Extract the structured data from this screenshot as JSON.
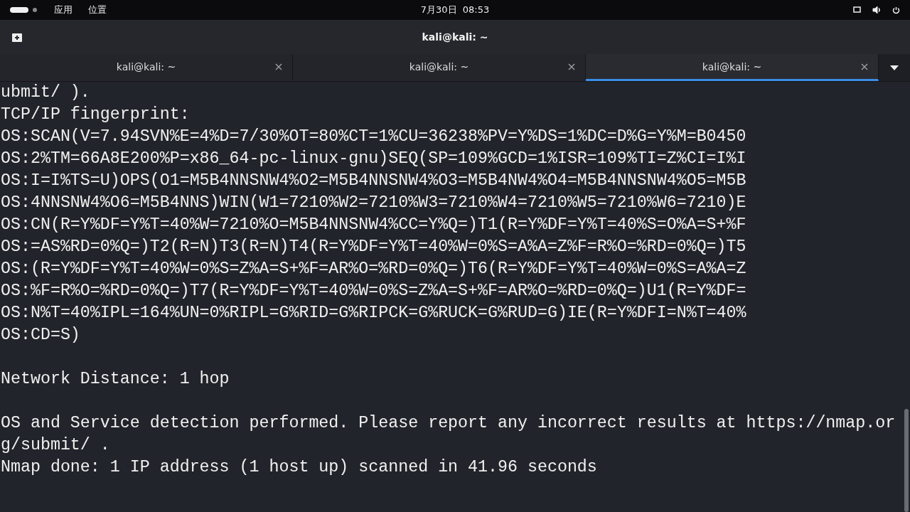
{
  "top_bar": {
    "menus": [
      "应用",
      "位置"
    ],
    "clock": "7月30日  08:53"
  },
  "window": {
    "title": "kali@kali: ~"
  },
  "tabs": [
    {
      "label": "kali@kali: ~",
      "selected": false
    },
    {
      "label": "kali@kali: ~",
      "selected": false
    },
    {
      "label": "kali@kali: ~",
      "selected": true
    }
  ],
  "terminal": {
    "lines": [
      {
        "kind": "text",
        "text": "ubmit/ )."
      },
      {
        "kind": "text",
        "text": "TCP/IP fingerprint:"
      },
      {
        "kind": "text",
        "text": "OS:SCAN(V=7.94SVN%E=4%D=7/30%OT=80%CT=1%CU=36238%PV=Y%DS=1%DC=D%G=Y%M=B0450"
      },
      {
        "kind": "text",
        "text": "OS:2%TM=66A8E200%P=x86_64-pc-linux-gnu)SEQ(SP=109%GCD=1%ISR=109%TI=Z%CI=I%I"
      },
      {
        "kind": "text",
        "text": "OS:I=I%TS=U)OPS(O1=M5B4NNSNW4%O2=M5B4NNSNW4%O3=M5B4NW4%O4=M5B4NNSNW4%O5=M5B"
      },
      {
        "kind": "text",
        "text": "OS:4NNSNW4%O6=M5B4NNS)WIN(W1=7210%W2=7210%W3=7210%W4=7210%W5=7210%W6=7210)E"
      },
      {
        "kind": "text",
        "text": "OS:CN(R=Y%DF=Y%T=40%W=7210%O=M5B4NNSNW4%CC=Y%Q=)T1(R=Y%DF=Y%T=40%S=O%A=S+%F"
      },
      {
        "kind": "text",
        "text": "OS:=AS%RD=0%Q=)T2(R=N)T3(R=N)T4(R=Y%DF=Y%T=40%W=0%S=A%A=Z%F=R%O=%RD=0%Q=)T5"
      },
      {
        "kind": "text",
        "text": "OS:(R=Y%DF=Y%T=40%W=0%S=Z%A=S+%F=AR%O=%RD=0%Q=)T6(R=Y%DF=Y%T=40%W=0%S=A%A=Z"
      },
      {
        "kind": "text",
        "text": "OS:%F=R%O=%RD=0%Q=)T7(R=Y%DF=Y%T=40%W=0%S=Z%A=S+%F=AR%O=%RD=0%Q=)U1(R=Y%DF="
      },
      {
        "kind": "text",
        "text": "OS:N%T=40%IPL=164%UN=0%RIPL=G%RID=G%RIPCK=G%RUCK=G%RUD=G)IE(R=Y%DFI=N%T=40%"
      },
      {
        "kind": "text",
        "text": "OS:CD=S)"
      },
      {
        "kind": "blank"
      },
      {
        "kind": "text",
        "text": "Network Distance: 1 hop"
      },
      {
        "kind": "blank"
      },
      {
        "kind": "text",
        "text": "OS and Service detection performed. Please report any incorrect results at https://nmap.or"
      },
      {
        "kind": "text",
        "text": "g/submit/ ."
      },
      {
        "kind": "text",
        "text": "Nmap done: 1 IP address (1 host up) scanned in 41.96 seconds"
      }
    ]
  }
}
